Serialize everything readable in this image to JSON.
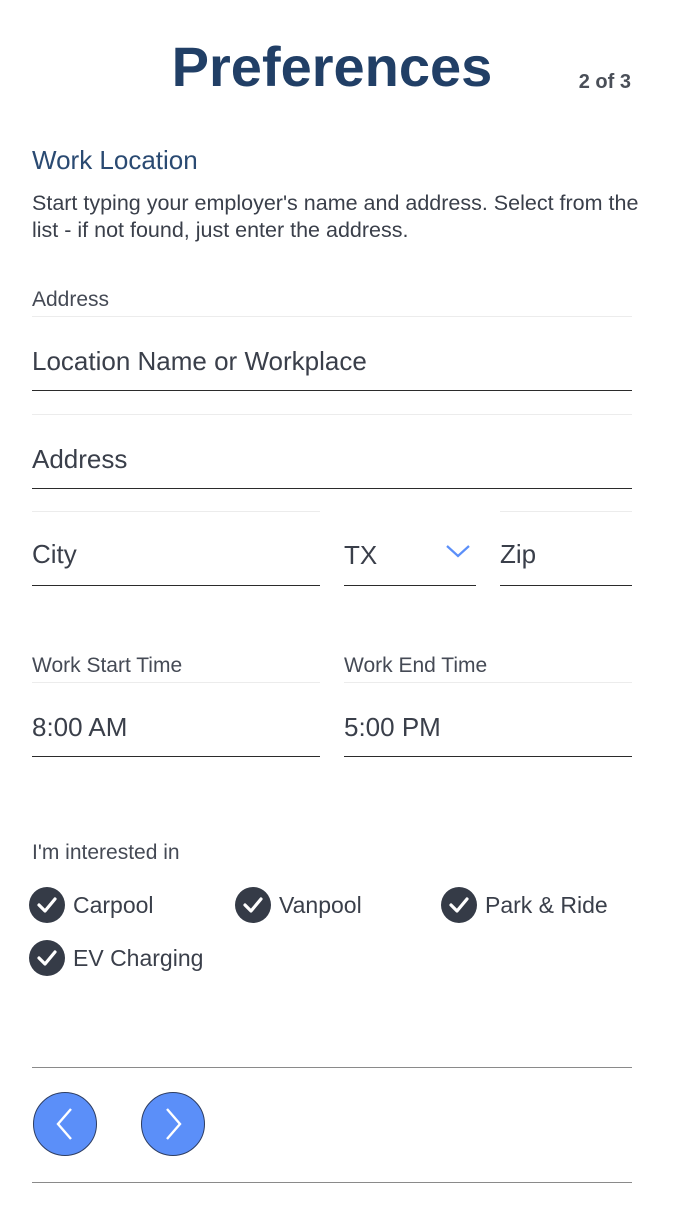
{
  "header": {
    "title": "Preferences",
    "step": "2 of 3"
  },
  "work_location": {
    "section_title": "Work Location",
    "instructions": "Start typing your employer's name and address. Select from the list - if not found, just enter the address.",
    "address_label": "Address",
    "location_placeholder": "Location Name or Workplace",
    "address_placeholder": "Address",
    "city_placeholder": "City",
    "state_value": "TX",
    "zip_placeholder": "Zip"
  },
  "times": {
    "start_label": "Work Start Time",
    "start_value": "8:00 AM",
    "end_label": "Work End Time",
    "end_value": "5:00 PM"
  },
  "interests": {
    "label": "I'm interested in",
    "options": [
      {
        "label": "Carpool",
        "checked": true
      },
      {
        "label": "Vanpool",
        "checked": true
      },
      {
        "label": "Park & Ride",
        "checked": true
      },
      {
        "label": "EV Charging",
        "checked": true
      }
    ]
  },
  "icons": {
    "check": "check-icon",
    "dropdown": "chevron-down-icon",
    "back": "chevron-left-icon",
    "next": "chevron-right-icon"
  },
  "colors": {
    "title": "#213f66",
    "accent_button": "#5b8ff9",
    "checkbox": "#353b47",
    "chevron": "#5b8ff9"
  }
}
